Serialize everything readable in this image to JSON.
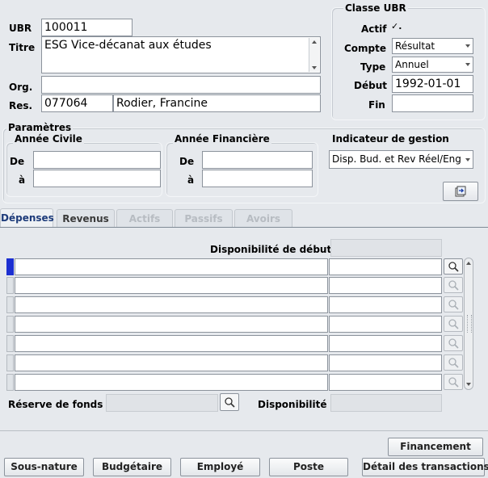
{
  "header": {
    "ubr_label": "UBR",
    "ubr_value": "100011",
    "titre_label": "Titre",
    "titre_value": "ESG Vice-décanat aux études",
    "org_label": "Org.",
    "org_value": "",
    "res_label": "Res.",
    "res_code": "077064",
    "res_name": "Rodier, Francine"
  },
  "classe": {
    "title": "Classe UBR",
    "actif_label": "Actif",
    "actif_check": "✓.",
    "compte_label": "Compte",
    "compte_value": "Résultat",
    "type_label": "Type",
    "type_value": "Annuel",
    "debut_label": "Début",
    "debut_value": "1992-01-01",
    "fin_label": "Fin",
    "fin_value": ""
  },
  "parametres": {
    "title": "Paramètres",
    "civile_title": "Année Civile",
    "financiere_title": "Année Financière",
    "de_label": "De",
    "a_label": "à",
    "civile_de": "",
    "civile_a": "",
    "fin_de": "",
    "fin_a": "",
    "indicateur_title": "Indicateur de gestion",
    "indicateur_value": "Disp. Bud. et Rev Réel/Eng"
  },
  "tabs": [
    {
      "label": "Dépenses"
    },
    {
      "label": "Revenus"
    },
    {
      "label": "Actifs"
    },
    {
      "label": "Passifs"
    },
    {
      "label": "Avoirs"
    }
  ],
  "grid": {
    "dispo_debut_label": "Disponibilité de début",
    "row_count": 7
  },
  "footer_fields": {
    "reserve_label": "Réserve de fonds",
    "disponibilite_label": "Disponibilité"
  },
  "buttons": {
    "financement": "Financement",
    "sous_nature": "Sous-nature",
    "budgetaire": "Budgétaire",
    "employe": "Employé",
    "poste": "Poste",
    "detail": "Détail des transactions"
  }
}
